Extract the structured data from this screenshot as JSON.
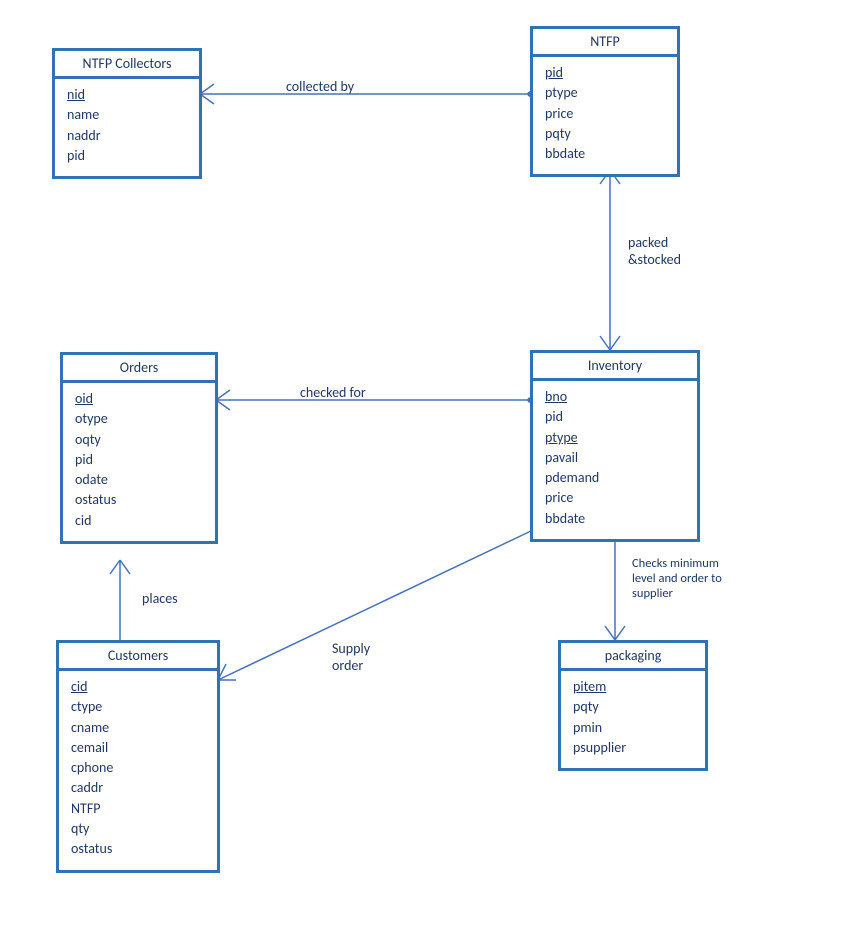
{
  "entities": {
    "ntfp_collectors": {
      "title": "NTFP Collectors",
      "attrs": [
        "nid",
        "name",
        "naddr",
        "pid"
      ],
      "pk": [
        "nid"
      ]
    },
    "ntfp": {
      "title": "NTFP",
      "attrs": [
        "pid",
        "ptype",
        "price",
        "pqty",
        "bbdate"
      ],
      "pk": [
        "pid"
      ]
    },
    "orders": {
      "title": "Orders",
      "attrs": [
        "oid",
        "otype",
        "oqty",
        "pid",
        "odate",
        "ostatus",
        "cid"
      ],
      "pk": [
        "oid"
      ]
    },
    "inventory": {
      "title": "Inventory",
      "attrs": [
        "bno",
        "pid",
        "ptype",
        "pavail",
        "pdemand",
        "price",
        "bbdate"
      ],
      "pk": [
        "bno",
        "ptype"
      ]
    },
    "customers": {
      "title": "Customers",
      "attrs": [
        "cid",
        "ctype",
        "cname",
        "cemail",
        "cphone",
        "caddr",
        "NTFP",
        "qty",
        "ostatus"
      ],
      "pk": [
        "cid"
      ]
    },
    "packaging": {
      "title": "packaging",
      "attrs": [
        "pitem",
        "pqty",
        "pmin",
        "psupplier"
      ],
      "pk": [
        "pitem"
      ]
    }
  },
  "relationships": {
    "collected_by": "collected by",
    "packed_stocked": "packed\n&stocked",
    "checked_for": "checked for",
    "places": "places",
    "supply_order": "Supply\norder",
    "checks_min": "Checks minimum\nlevel and order to\nsupplier"
  }
}
